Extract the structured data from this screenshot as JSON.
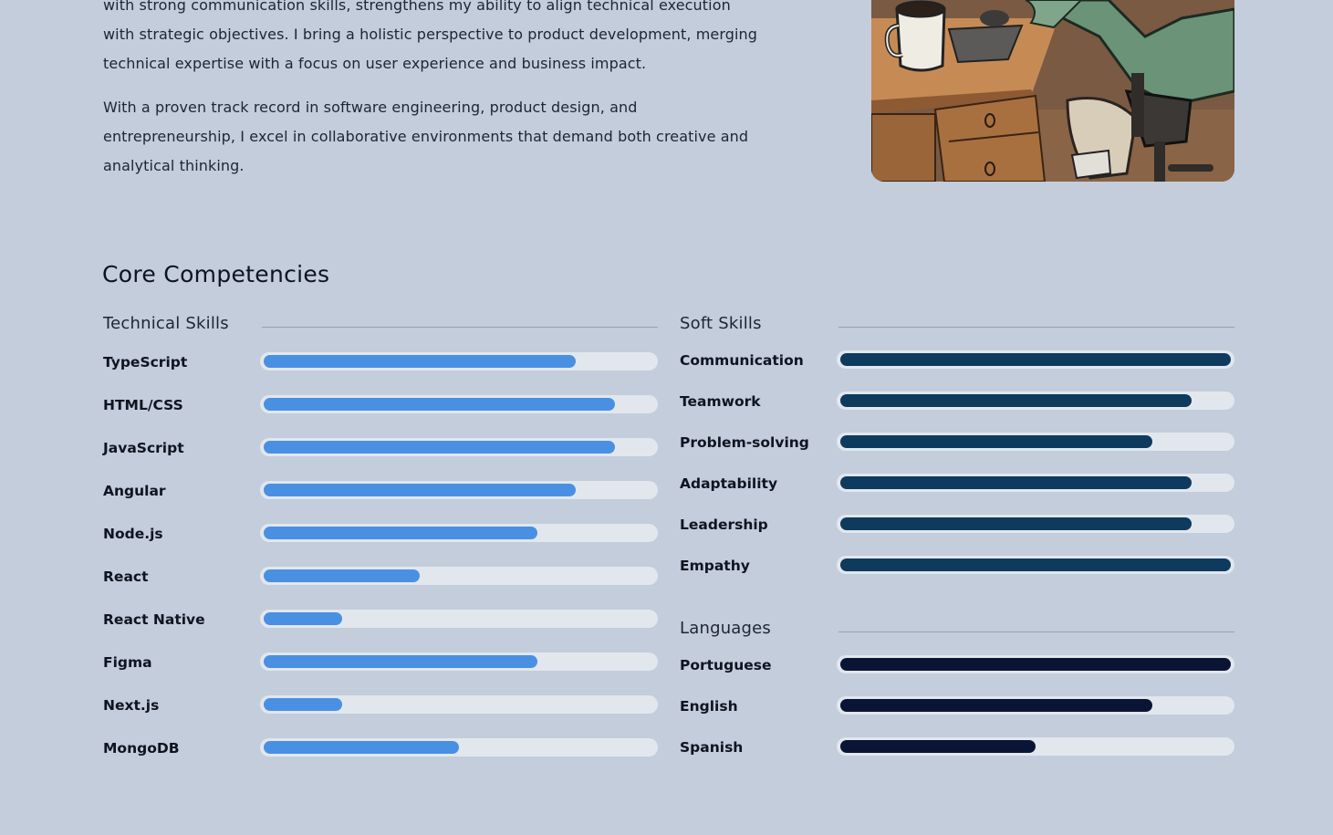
{
  "about": {
    "paragraphs": [
      "with strong communication skills, strengthens my ability to align technical execution with strategic objectives. I bring a holistic perspective to product development, merging technical expertise with a focus on user experience and business impact.",
      "With a proven track record in software engineering, product design, and entrepreneurship, I excel in collaborative environments that demand both creative and analytical thinking."
    ]
  },
  "competencies": {
    "title": "Core Competencies",
    "technical": {
      "title": "Technical Skills",
      "items": [
        {
          "label": "TypeScript",
          "level": 0.8
        },
        {
          "label": "HTML/CSS",
          "level": 0.9
        },
        {
          "label": "JavaScript",
          "level": 0.9
        },
        {
          "label": "Angular",
          "level": 0.8
        },
        {
          "label": "Node.js",
          "level": 0.7
        },
        {
          "label": "React",
          "level": 0.4
        },
        {
          "label": "React Native",
          "level": 0.2
        },
        {
          "label": "Figma",
          "level": 0.7
        },
        {
          "label": "Next.js",
          "level": 0.2
        },
        {
          "label": "MongoDB",
          "level": 0.5
        }
      ]
    },
    "soft": {
      "title": "Soft Skills",
      "items": [
        {
          "label": "Communication",
          "level": 1.0
        },
        {
          "label": "Teamwork",
          "level": 0.9
        },
        {
          "label": "Problem-solving",
          "level": 0.8
        },
        {
          "label": "Adaptability",
          "level": 0.9
        },
        {
          "label": "Leadership",
          "level": 0.9
        },
        {
          "label": "Empathy",
          "level": 1.0
        }
      ]
    },
    "languages": {
      "title": "Languages",
      "items": [
        {
          "label": "Portuguese",
          "level": 1.0
        },
        {
          "label": "English",
          "level": 0.8
        },
        {
          "label": "Spanish",
          "level": 0.5
        }
      ]
    }
  },
  "colors": {
    "background": "#c3cddb",
    "technical_bar": "#4a90e2",
    "soft_bar": "#0e3a5e",
    "language_bar": "#0a1535",
    "track": "#e2e7ee"
  },
  "illustration": {
    "icon": "developer-at-desk-illustration"
  }
}
